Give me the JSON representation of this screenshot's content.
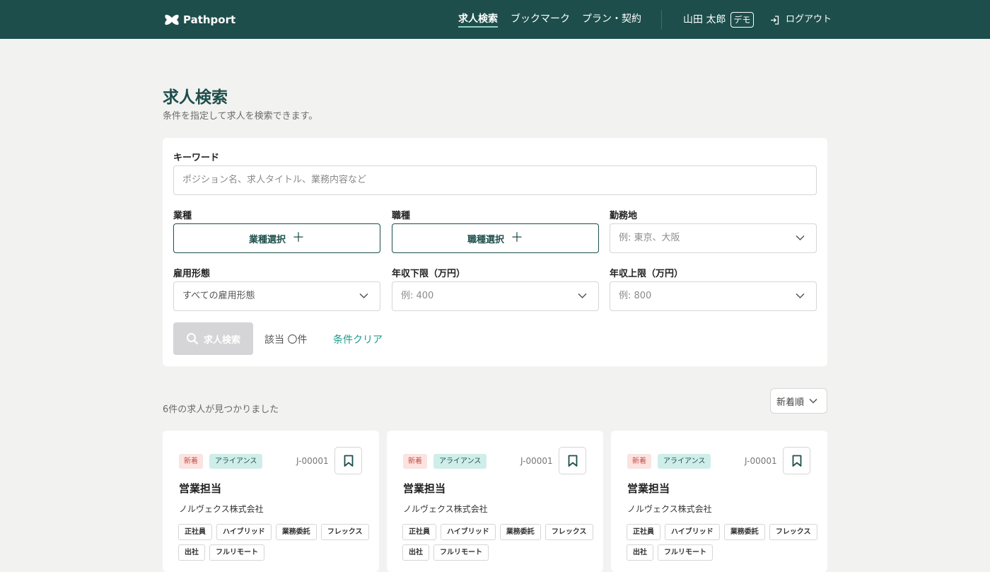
{
  "header": {
    "brand": "Pathport",
    "nav": [
      {
        "label": "求人検索",
        "active": true
      },
      {
        "label": "ブックマーク",
        "active": false
      },
      {
        "label": "プラン・契約",
        "active": false
      }
    ],
    "user_name": "山田 太郎",
    "user_badge": "デモ",
    "logout_label": "ログアウト"
  },
  "page": {
    "title": "求人検索",
    "subtitle": "条件を指定して求人を検索できます。"
  },
  "search": {
    "keyword_label": "キーワード",
    "keyword_placeholder": "ポジション名、求人タイトル、業務内容など",
    "industry_label": "業種",
    "industry_button": "業種選択",
    "occupation_label": "職種",
    "occupation_button": "職種選択",
    "location_label": "勤務地",
    "location_placeholder": "例: 東京、大阪",
    "employment_label": "雇用形態",
    "employment_value": "すべての雇用形態",
    "salary_min_label": "年収下限（万円）",
    "salary_min_placeholder": "例: 400",
    "salary_max_label": "年収上限（万円）",
    "salary_max_placeholder": "例: 800",
    "search_button": "求人検索",
    "match_count": "該当 〇件",
    "clear_label": "条件クリア"
  },
  "results": {
    "summary": "6件の求人が見つかりました",
    "sort_value": "新着順"
  },
  "cards": [
    {
      "badge_new": "新着",
      "badge_type": "アライアンス",
      "job_id": "J-00001",
      "title": "営業担当",
      "company": "ノルヴェクス株式会社",
      "tags": [
        "正社員",
        "ハイブリッド",
        "業務委託",
        "フレックス",
        "出社",
        "フルリモート"
      ]
    },
    {
      "badge_new": "新着",
      "badge_type": "アライアンス",
      "job_id": "J-00001",
      "title": "営業担当",
      "company": "ノルヴェクス株式会社",
      "tags": [
        "正社員",
        "ハイブリッド",
        "業務委託",
        "フレックス",
        "出社",
        "フルリモート"
      ]
    },
    {
      "badge_new": "新着",
      "badge_type": "アライアンス",
      "job_id": "J-00001",
      "title": "営業担当",
      "company": "ノルヴェクス株式会社",
      "tags": [
        "正社員",
        "ハイブリッド",
        "業務委託",
        "フレックス",
        "出社",
        "フルリモート"
      ]
    }
  ],
  "icons": {
    "logo": "brand-logo-icon",
    "logout": "logout-icon",
    "chevron": "chevron-down-icon",
    "search": "search-icon",
    "bookmark": "bookmark-icon"
  },
  "colors": {
    "header_bg": "#1d4e4b",
    "accent": "#1a9b8a",
    "new_badge": "#c94a42"
  }
}
